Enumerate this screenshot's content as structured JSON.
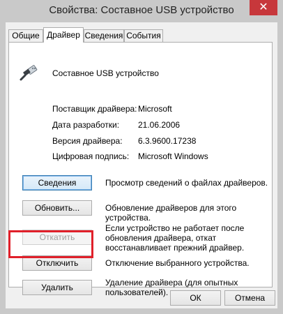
{
  "window": {
    "title": "Свойства: Составное USB устройство",
    "close_glyph": "✕"
  },
  "tabs": [
    {
      "label": "Общие"
    },
    {
      "label": "Драйвер",
      "active": true
    },
    {
      "label": "Сведения"
    },
    {
      "label": "События"
    }
  ],
  "device": {
    "icon": "usb-plug-icon",
    "name": "Составное USB устройство"
  },
  "properties": [
    {
      "label": "Поставщик драйвера:",
      "value": "Microsoft"
    },
    {
      "label": "Дата разработки:",
      "value": "21.06.2006"
    },
    {
      "label": "Версия драйвера:",
      "value": "6.3.9600.17238"
    },
    {
      "label": "Цифровая подпись:",
      "value": "Microsoft Windows"
    }
  ],
  "actions": [
    {
      "button": "Сведения",
      "description": "Просмотр сведений о файлах драйверов."
    },
    {
      "button": "Обновить...",
      "description": "Обновление драйверов для этого устройства."
    },
    {
      "button": "Откатить",
      "description": "Если устройство не работает после обновления драйвера, откат восстанавливает прежний драйвер.",
      "enabled": false
    },
    {
      "button": "Отключить",
      "description": "Отключение выбранного устройства."
    },
    {
      "button": "Удалить",
      "description": "Удаление драйвера (для опытных пользователей)."
    }
  ],
  "dialog_buttons": {
    "ok": "ОК",
    "cancel": "Отмена"
  },
  "colors": {
    "highlight_frame": "#e0202a",
    "close_button": "#c7373b"
  }
}
